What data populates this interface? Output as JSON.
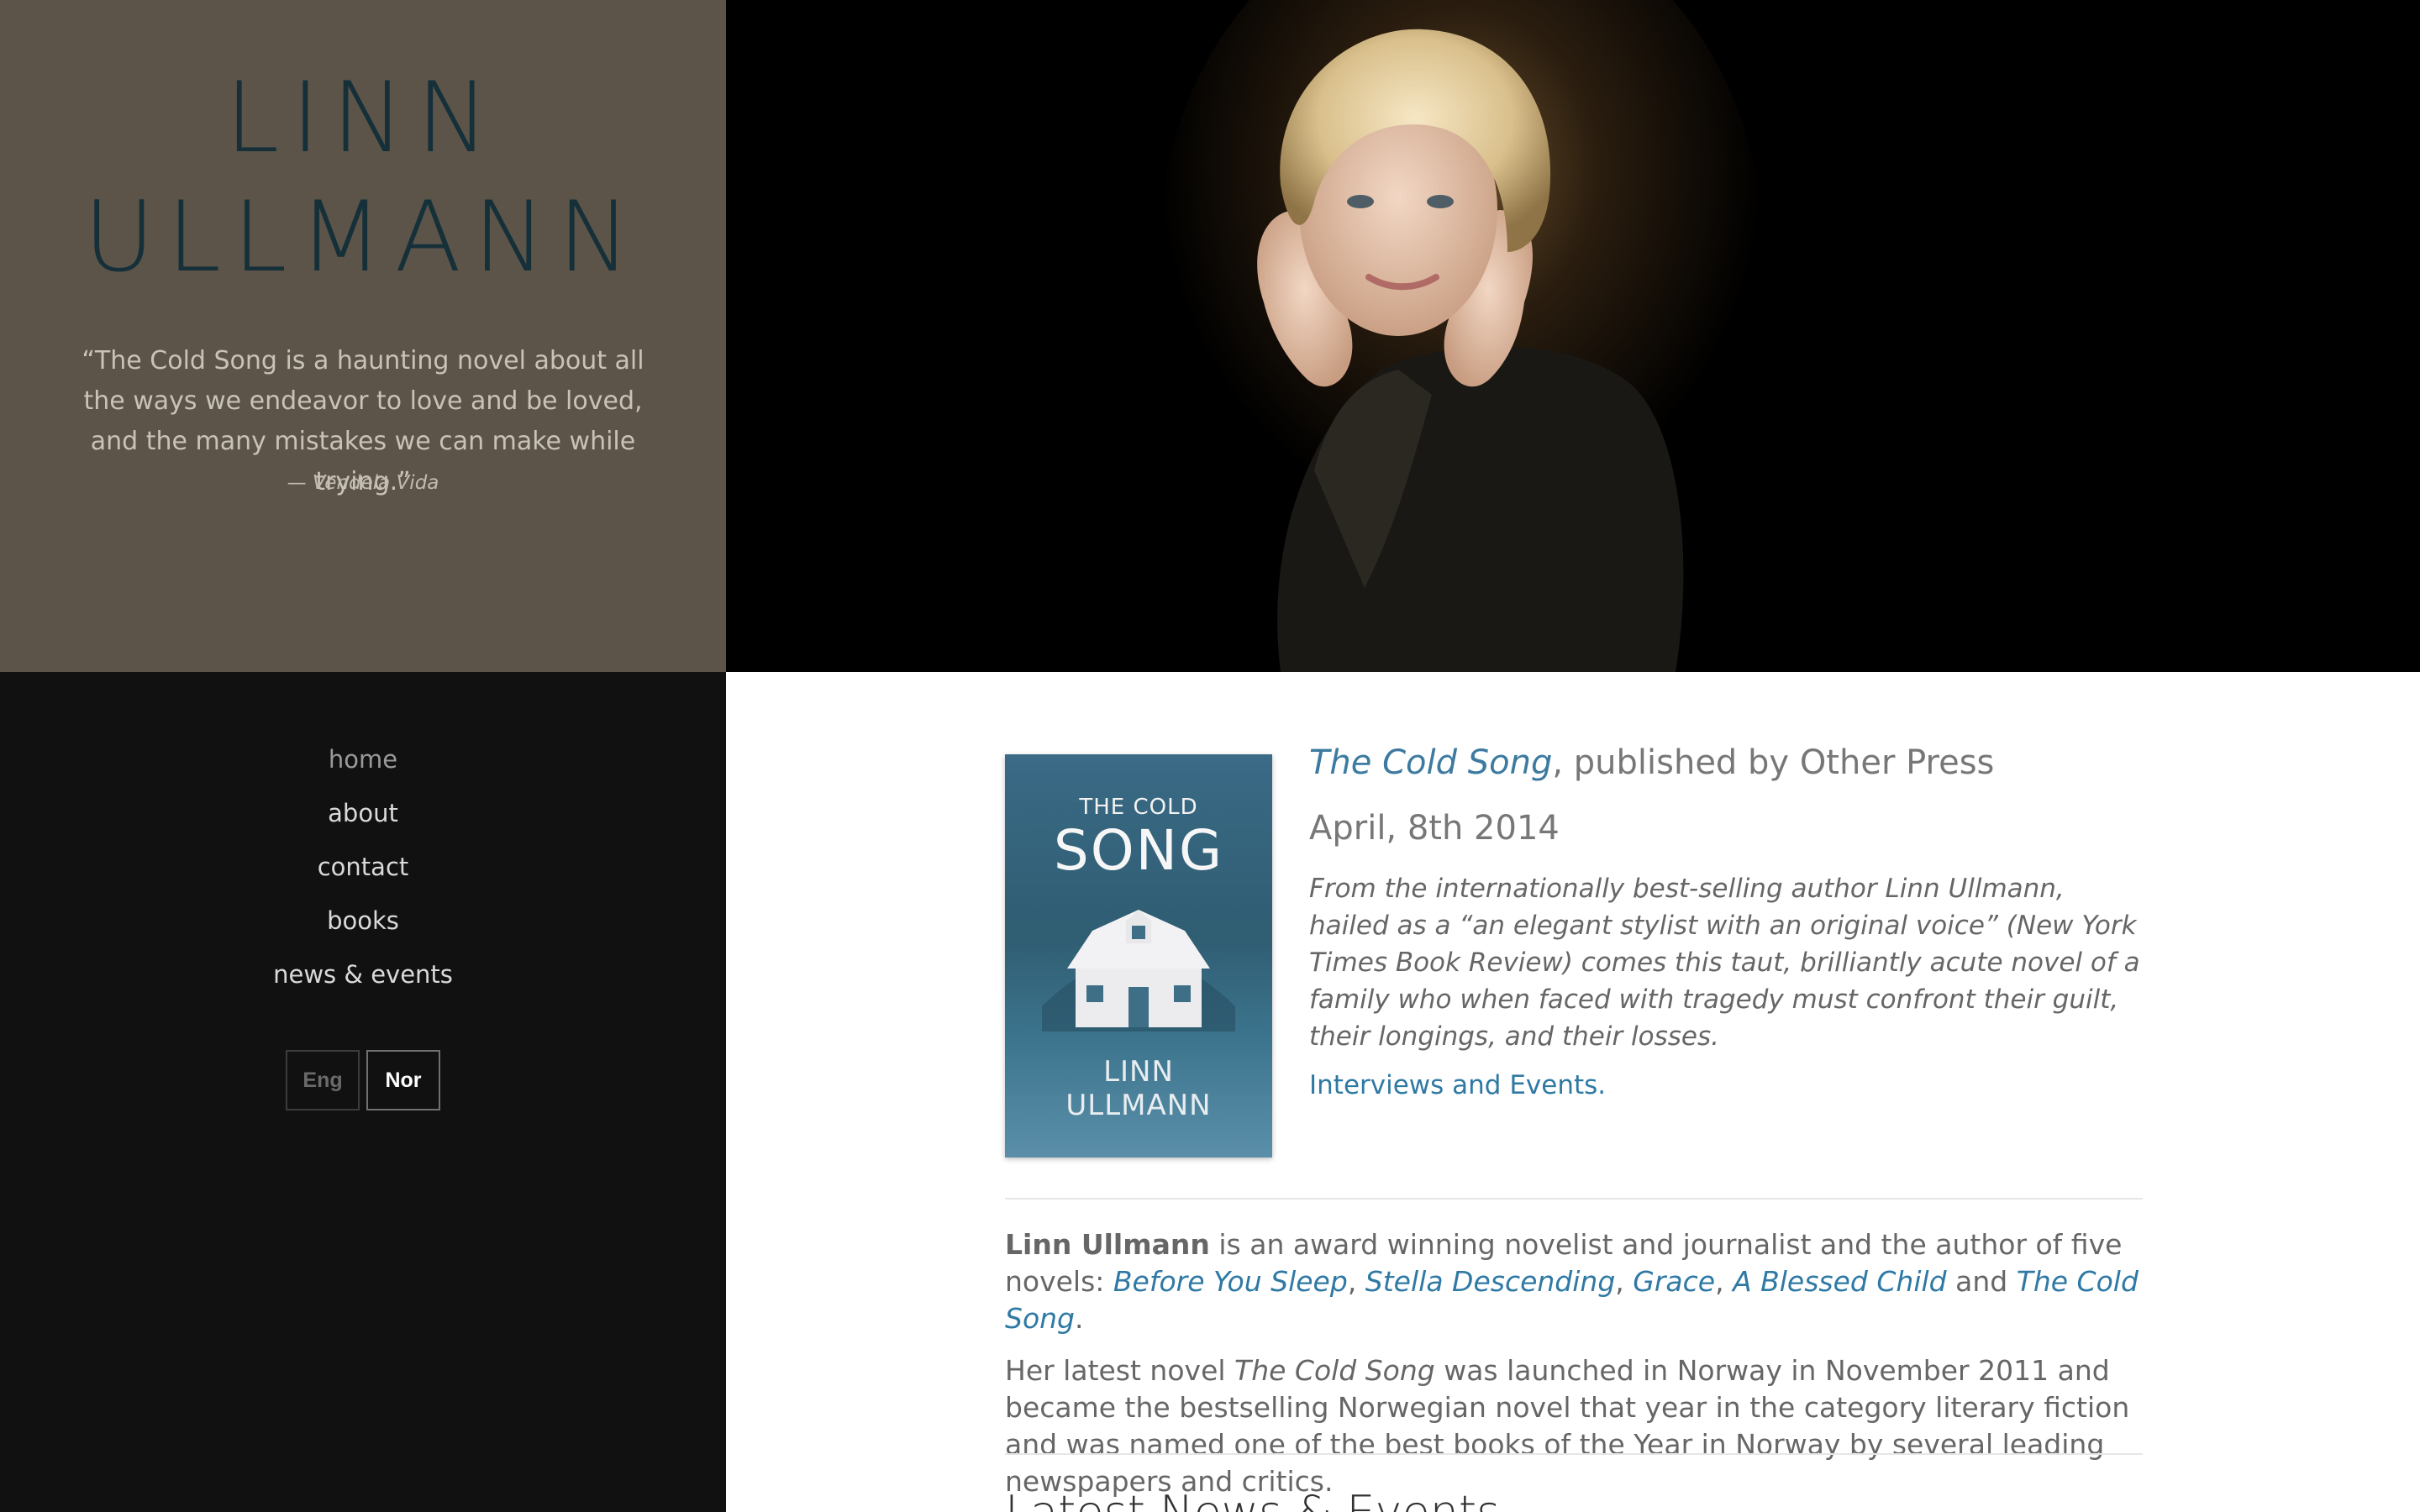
{
  "brand": {
    "name_line1": "LINN",
    "name_line2": "ULLMANN",
    "quote_text": "“The Cold Song is a haunting novel about all the ways we endeavor to love and be loved, and the many mistakes we can make while trying.”",
    "quote_author": "— Vendela Vida"
  },
  "hero": {
    "image_alt": "Portrait photo of Linn Ullmann"
  },
  "nav": {
    "items": [
      {
        "label": "home"
      },
      {
        "label": "about"
      },
      {
        "label": "contact"
      },
      {
        "label": "books"
      },
      {
        "label": "news & events"
      }
    ]
  },
  "language": {
    "eng": "Eng",
    "nor": "Nor",
    "selected": "Nor"
  },
  "book": {
    "cover": {
      "title_small": "THE COLD",
      "title_big": "SONG",
      "author_line1": "LINN",
      "author_line2": "ULLMANN"
    },
    "title": "The Cold Song",
    "publisher_text": ", published by Other Press",
    "date": "April, 8th 2014",
    "blurb": "From the internationally best-selling author Linn Ullmann, hailed as a “an elegant stylist with an original voice” (New York Times Book Review) comes this taut, brilliantly acute novel of a family who when faced with tragedy must confront their guilt, their longings, and their losses.",
    "events_link": "Interviews and Events."
  },
  "bio": {
    "name": "Linn Ullmann",
    "intro": " is an award winning novelist and journalist and the author of five novels: ",
    "novels": [
      "Before You Sleep",
      "Stella Descending",
      "Grace",
      "A Blessed Child",
      "The Cold Song"
    ],
    "sep": ", ",
    "and": " and ",
    "end": ".",
    "p2_before": "Her latest novel ",
    "p2_title": "The Cold Song",
    "p2_after": " was launched in Norway in November 2011 and became the bestselling Norwegian novel that year in the category literary fiction and was named one of the best books of the Year in Norway by several leading newspapers and critics."
  },
  "news": {
    "heading": "Latest News & Events"
  },
  "colors": {
    "brand_bg": "#5c5449",
    "sidebar_bg": "#111111",
    "link": "#2f79a4",
    "name_text": "#16303a"
  }
}
